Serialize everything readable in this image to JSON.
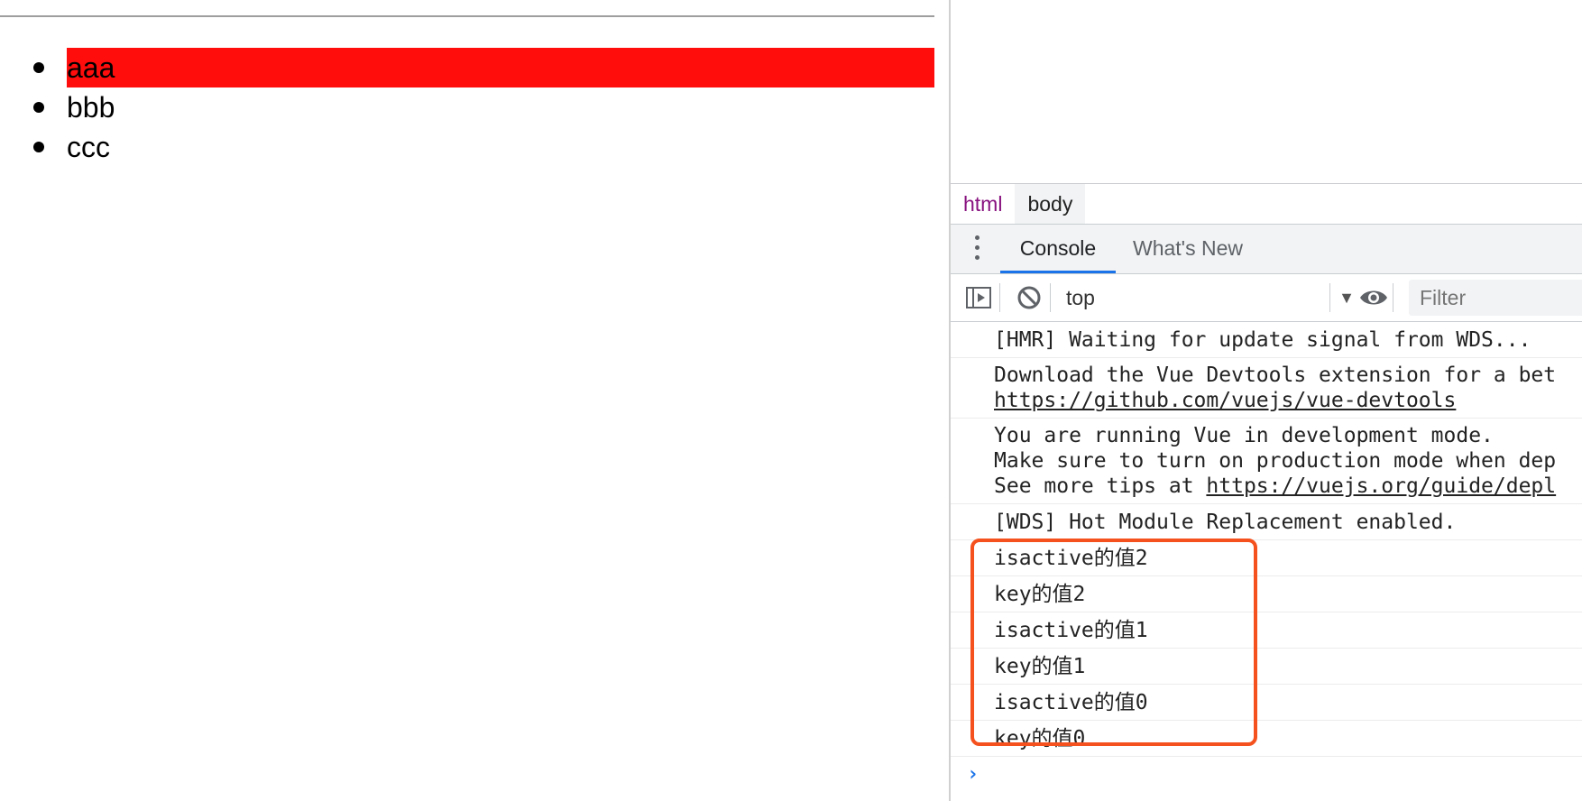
{
  "page": {
    "list_items": [
      {
        "label": "aaa",
        "active": true
      },
      {
        "label": "bbb",
        "active": false
      },
      {
        "label": "ccc",
        "active": false
      }
    ],
    "active_background": "#ff0d0d"
  },
  "devtools": {
    "breadcrumb": [
      "html",
      "body"
    ],
    "tabs": {
      "console": "Console",
      "whats_new": "What's New",
      "selected": "Console"
    },
    "toolbar": {
      "context": "top",
      "filter_placeholder": "Filter"
    },
    "messages": [
      {
        "lines": [
          "[HMR] Waiting for update signal from WDS..."
        ]
      },
      {
        "lines": [
          "Download the Vue Devtools extension for a bet"
        ],
        "link": "https://github.com/vuejs/vue-devtools"
      },
      {
        "lines": [
          "You are running Vue in development mode.",
          "Make sure to turn on production mode when dep"
        ],
        "prefix": "See more tips at ",
        "link": "https://vuejs.org/guide/depl"
      },
      {
        "lines": [
          "[WDS] Hot Module Replacement enabled."
        ]
      },
      {
        "lines": [
          "isactive的值2"
        ]
      },
      {
        "lines": [
          "key的值2"
        ]
      },
      {
        "lines": [
          "isactive的值1"
        ]
      },
      {
        "lines": [
          "key的值1"
        ]
      },
      {
        "lines": [
          "isactive的值0"
        ]
      },
      {
        "lines": [
          "key的值0"
        ]
      }
    ],
    "highlight_color": "#f4511e",
    "prompt_symbol": "›"
  }
}
